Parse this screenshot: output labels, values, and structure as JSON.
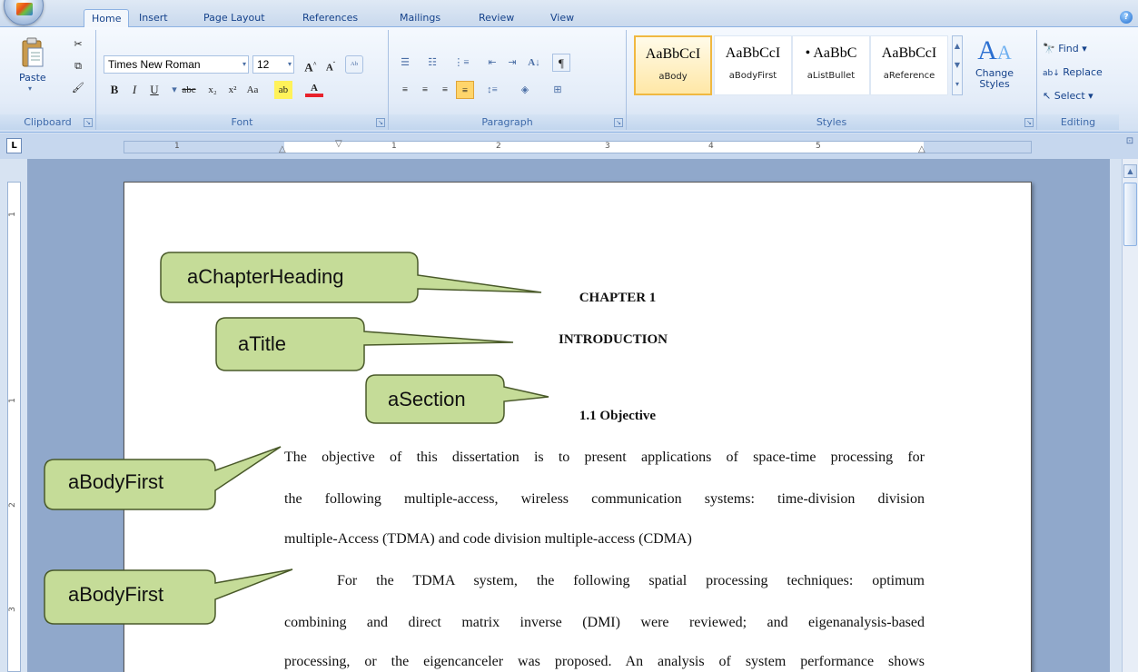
{
  "tabs": [
    {
      "label": "Home",
      "active": true
    },
    {
      "label": "Insert",
      "active": false
    },
    {
      "label": "Page Layout",
      "active": false
    },
    {
      "label": "References",
      "active": false
    },
    {
      "label": "Mailings",
      "active": false
    },
    {
      "label": "Review",
      "active": false
    },
    {
      "label": "View",
      "active": false
    }
  ],
  "ribbon": {
    "clipboard": {
      "paste_label": "Paste",
      "group_label": "Clipboard"
    },
    "font": {
      "family": "Times New Roman",
      "size": "12",
      "group_label": "Font"
    },
    "paragraph": {
      "group_label": "Paragraph"
    },
    "styles": {
      "group_label": "Styles",
      "items": [
        {
          "sample": "AaBbCcI",
          "name": "aBody",
          "selected": true
        },
        {
          "sample": "AaBbCcI",
          "name": "aBodyFirst",
          "selected": false
        },
        {
          "sample": "• AaBbC",
          "name": "aListBullet",
          "selected": false
        },
        {
          "sample": "AaBbCcI",
          "name": "aReference",
          "selected": false
        }
      ],
      "change_styles_label": "Change\nStyles"
    },
    "editing": {
      "group_label": "Editing",
      "find_label": "Find",
      "replace_label": "Replace",
      "select_label": "Select"
    }
  },
  "ruler": {
    "numbers": [
      "1",
      "1",
      "2",
      "3",
      "4",
      "5"
    ]
  },
  "vruler": {
    "numbers": [
      "1",
      "1",
      "2",
      "3"
    ]
  },
  "document": {
    "chapter_heading": "CHAPTER 1",
    "title": "INTRODUCTION",
    "section": "1.1 Objective",
    "paragraph1": [
      "The objective of this dissertation is to present applications of space-time processing for",
      "the following multiple-access, wireless communication systems: time-division division",
      "multiple-Access (TDMA) and code division multiple-access (CDMA)"
    ],
    "paragraph2": [
      "For the TDMA system, the following spatial processing techniques: optimum",
      "combining and direct matrix inverse (DMI) were reviewed; and eigenanalysis-based",
      "processing, or the eigencanceler was proposed. An analysis of system performance shows"
    ]
  },
  "callouts": [
    {
      "label": "aChapterHeading"
    },
    {
      "label": "aTitle"
    },
    {
      "label": "aSection"
    },
    {
      "label": "aBodyFirst"
    },
    {
      "label": "aBodyFirst"
    }
  ],
  "colors": {
    "callout_fill": "#c5dc98",
    "callout_stroke": "#4a5a2a",
    "selected_style": "#f0b841"
  }
}
